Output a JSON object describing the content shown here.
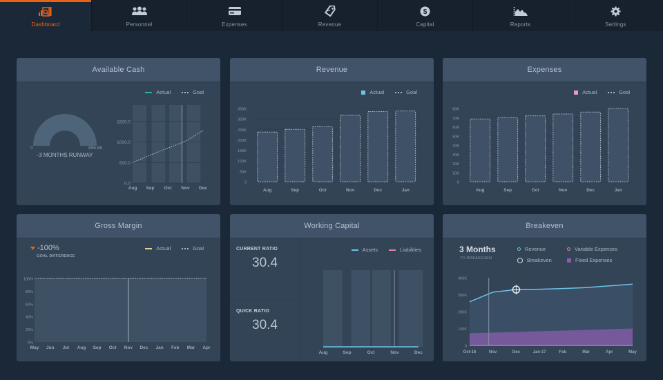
{
  "nav": {
    "items": [
      {
        "label": "Dashboard",
        "icon": "dashboard-icon",
        "active": true
      },
      {
        "label": "Personnel",
        "icon": "people-icon"
      },
      {
        "label": "Expenses",
        "icon": "credit-card-icon"
      },
      {
        "label": "Revenue",
        "icon": "tag-icon"
      },
      {
        "label": "Capital",
        "icon": "dollar-coin-icon"
      },
      {
        "label": "Reports",
        "icon": "area-chart-icon"
      },
      {
        "label": "Settings",
        "icon": "gear-icon"
      }
    ],
    "accent": "#e8631a"
  },
  "cards": {
    "available_cash": {
      "title": "Available Cash",
      "gauge_min": "0",
      "gauge_max": "856.8K",
      "runway": "-3 MONTHS RUNWAY",
      "legend": {
        "actual": "Actual",
        "goal": "Goal"
      }
    },
    "revenue": {
      "title": "Revenue",
      "legend": {
        "actual": "Actual",
        "goal": "Goal"
      }
    },
    "expenses": {
      "title": "Expenses",
      "legend": {
        "actual": "Actual",
        "goal": "Goal"
      }
    },
    "gross_margin": {
      "title": "Gross Margin",
      "goal_difference_value": "-100%",
      "goal_difference_label": "GOAL DIFFERENCE",
      "legend": {
        "actual": "Actual",
        "goal": "Goal"
      }
    },
    "working_capital": {
      "title": "Working Capital",
      "current_ratio_label": "CURRENT RATIO",
      "current_ratio_value": "30.4",
      "quick_ratio_label": "QUICK RATIO",
      "quick_ratio_value": "30.4",
      "legend": {
        "assets": "Assets",
        "liabilities": "Liabilities"
      }
    },
    "breakeven": {
      "title": "Breakeven",
      "months": "3 Months",
      "months_sub": "TO BREAKEVEN",
      "legend": {
        "revenue": "Revenue",
        "breakeven": "Breakeven",
        "variable": "Variable Expenses",
        "fixed": "Fixed Expenses"
      }
    }
  },
  "colors": {
    "actual_teal": "#2bb5a0",
    "revenue_blue": "#6cc3e8",
    "expenses_pink": "#e59acb",
    "margin_yellow": "#e8d08a",
    "liabilities_pink": "#e57ea7",
    "fixed_purple": "#8a5fa8"
  },
  "chart_data": [
    {
      "id": "available_cash",
      "type": "line",
      "title": "Available Cash",
      "categories": [
        "Aug",
        "Sep",
        "Oct",
        "Nov",
        "Dec"
      ],
      "yticks": [
        "0.0",
        "500.0",
        "1000.0",
        "1500.0"
      ],
      "ylim": [
        0,
        1900
      ],
      "series": [
        {
          "name": "Goal",
          "style": "dotted",
          "values": [
            500,
            680,
            850,
            1020,
            1280
          ]
        }
      ],
      "current_marker": "Nov"
    },
    {
      "id": "revenue",
      "type": "bar",
      "title": "Revenue",
      "categories": [
        "Aug",
        "Sep",
        "Oct",
        "Nov",
        "Dec",
        "Jan"
      ],
      "yticks": [
        "0",
        "50K",
        "100K",
        "150K",
        "200K",
        "250K",
        "300K",
        "350K"
      ],
      "ylim": [
        0,
        350000
      ],
      "series": [
        {
          "name": "Goal",
          "style": "dotted-outline",
          "values": [
            237000,
            250000,
            263000,
            318000,
            335000,
            338000
          ]
        }
      ]
    },
    {
      "id": "expenses",
      "type": "bar",
      "title": "Expenses",
      "categories": [
        "Aug",
        "Sep",
        "Oct",
        "Nov",
        "Dec",
        "Jan"
      ],
      "yticks": [
        "0",
        "10K",
        "20K",
        "30K",
        "40K",
        "50K",
        "60K",
        "70K",
        "80K"
      ],
      "ylim": [
        0,
        80000
      ],
      "series": [
        {
          "name": "Goal",
          "style": "dotted-outline",
          "values": [
            68500,
            70000,
            72000,
            74000,
            76000,
            80000
          ]
        }
      ]
    },
    {
      "id": "gross_margin",
      "type": "line",
      "title": "Gross Margin",
      "categories": [
        "May",
        "Jun",
        "Jul",
        "Aug",
        "Sep",
        "Oct",
        "Nov",
        "Dec",
        "Jan",
        "Feb",
        "Mar",
        "Apr"
      ],
      "yticks": [
        "0%",
        "20%",
        "40%",
        "60%",
        "80%",
        "100%"
      ],
      "ylim": [
        0,
        100
      ],
      "series": [
        {
          "name": "Goal",
          "style": "dotted",
          "values": [
            100,
            100,
            100,
            100,
            100,
            100,
            100,
            100,
            100,
            100,
            100,
            100
          ]
        }
      ],
      "current_marker": "Nov"
    },
    {
      "id": "working_capital",
      "type": "line",
      "title": "Working Capital",
      "categories": [
        "Aug",
        "Sep",
        "Oct",
        "Nov",
        "Dec"
      ],
      "series": [
        {
          "name": "Assets",
          "values": [
            0,
            0,
            0,
            0,
            0
          ]
        },
        {
          "name": "Liabilities",
          "values": [
            0,
            0,
            0,
            0,
            0
          ]
        }
      ],
      "current_marker": "Nov"
    },
    {
      "id": "breakeven",
      "type": "area",
      "title": "Breakeven",
      "categories": [
        "Oct-16",
        "Nov",
        "Dec",
        "Jan-17",
        "Feb",
        "Mar",
        "Apr",
        "May"
      ],
      "yticks": [
        "0",
        "100K",
        "200K",
        "300K",
        "400K"
      ],
      "ylim": [
        0,
        400000
      ],
      "series": [
        {
          "name": "Revenue",
          "values": [
            258000,
            315000,
            330000,
            332000,
            336000,
            342000,
            352000,
            362000
          ]
        },
        {
          "name": "Fixed Expenses",
          "values": [
            72000,
            76000,
            80000,
            84000,
            88000,
            92000,
            96000,
            100000
          ]
        },
        {
          "name": "Variable Expenses",
          "values": [
            2000,
            2000,
            2000,
            2000,
            2000,
            2000,
            2000,
            2000
          ]
        }
      ],
      "breakeven_point": {
        "x": "Dec",
        "y": 330000
      },
      "current_marker": "Nov"
    }
  ]
}
